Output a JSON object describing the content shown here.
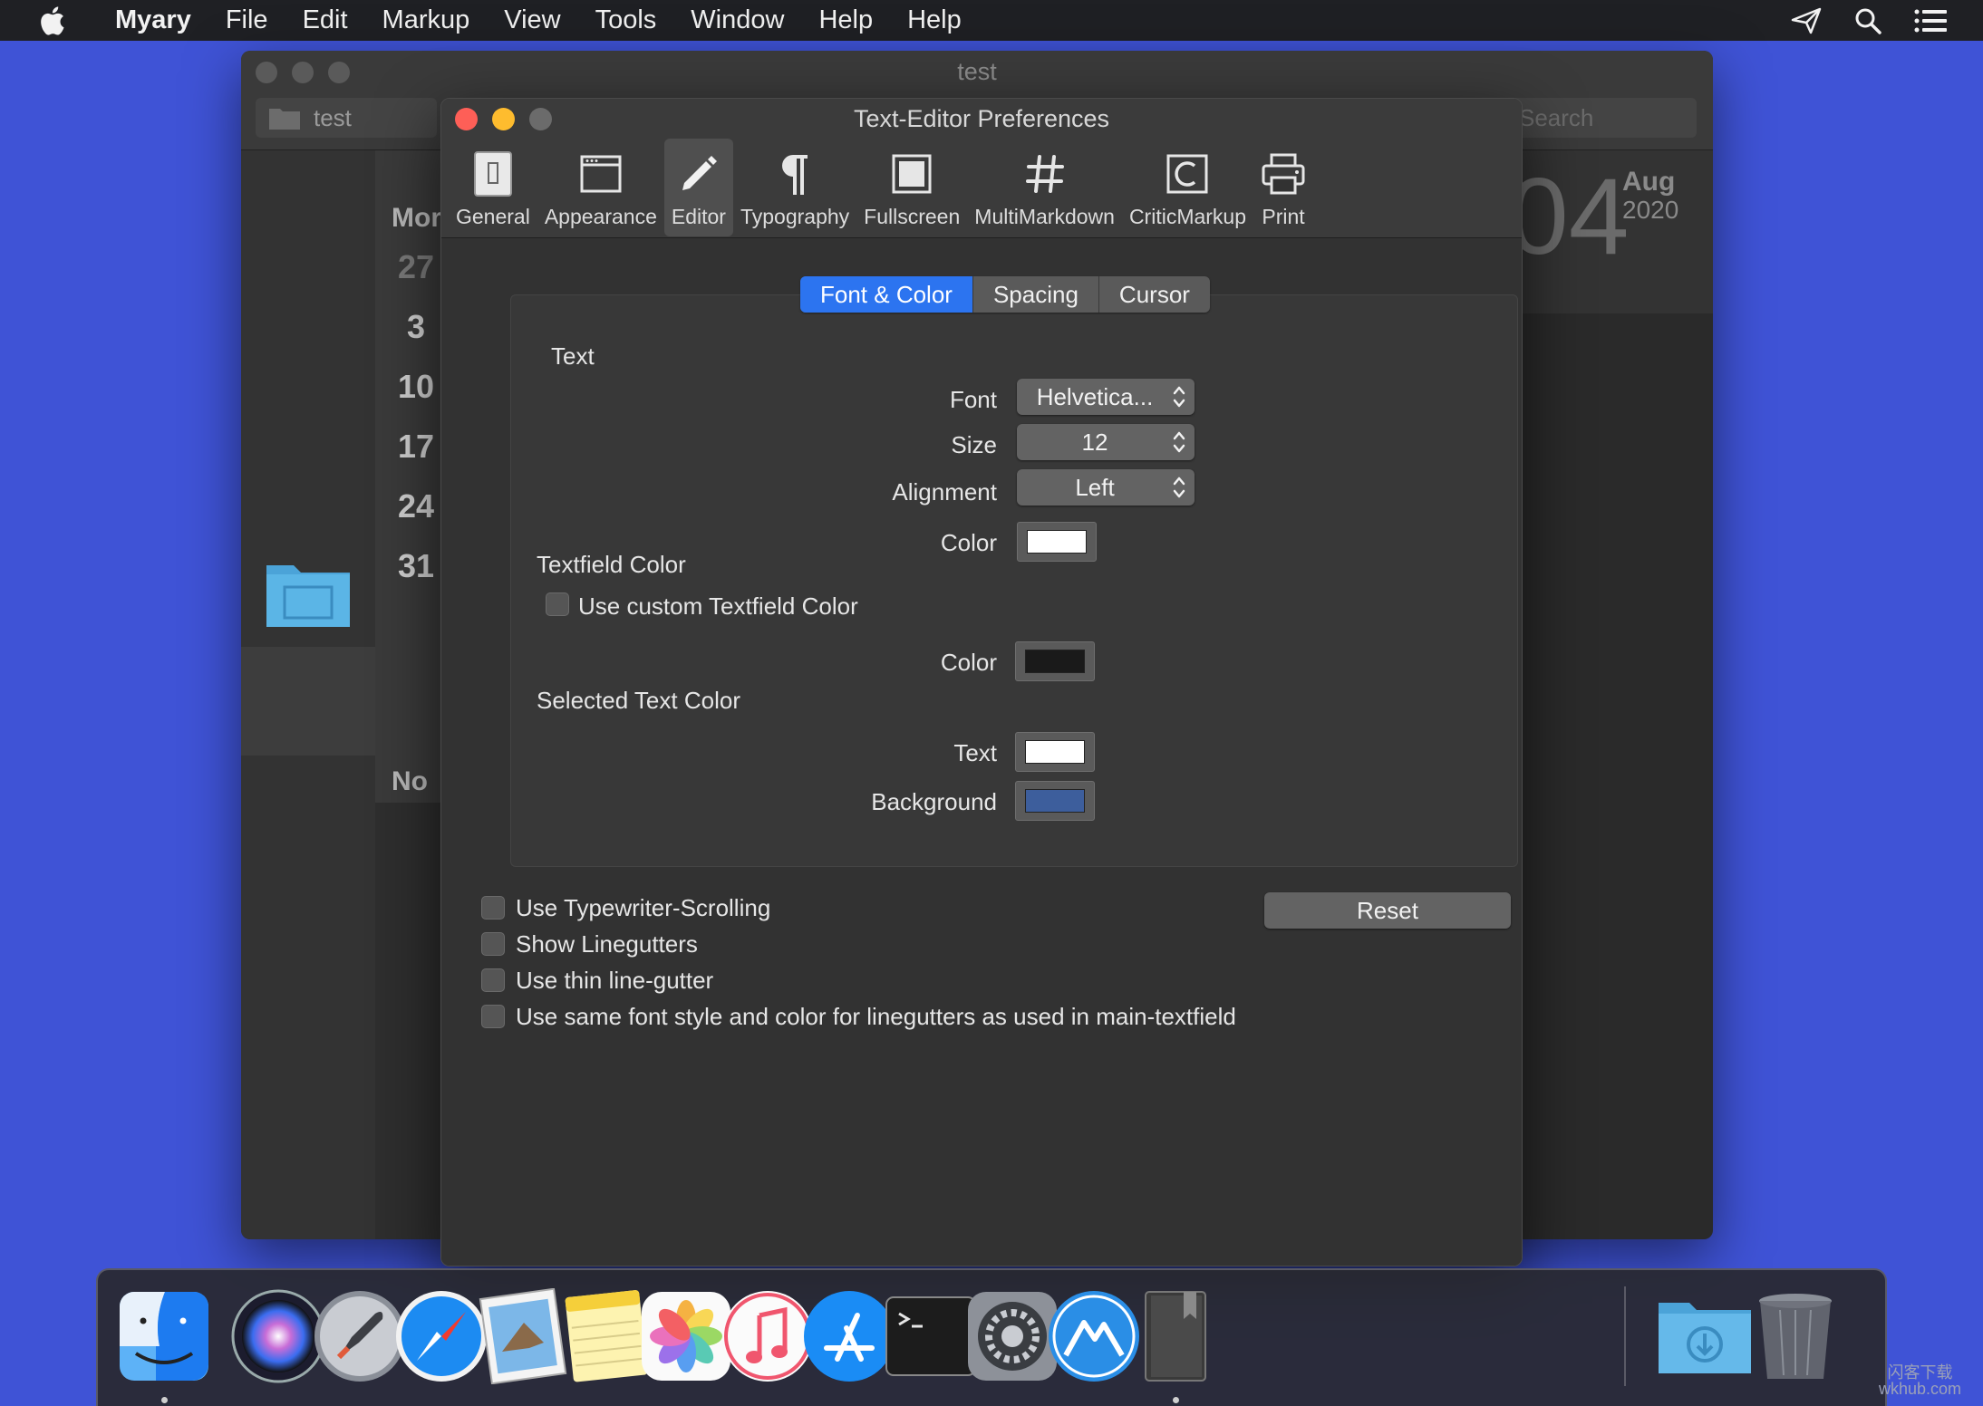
{
  "menubar": {
    "app_name": "Myary",
    "items": [
      "File",
      "Edit",
      "Markup",
      "View",
      "Tools",
      "Window",
      "Help",
      "Help"
    ]
  },
  "background_window": {
    "title": "test",
    "tab_label": "test",
    "search_placeholder": "Search",
    "weekday_header": "Mor",
    "dates": [
      "27",
      "3",
      "10",
      "17",
      "24",
      "31"
    ],
    "notes_header": "No",
    "big_day": "04",
    "month": "Aug",
    "year": "2020"
  },
  "prefs": {
    "title": "Text-Editor Preferences",
    "toolbar": [
      {
        "label": "General",
        "icon": "general-icon"
      },
      {
        "label": "Appearance",
        "icon": "appearance-icon"
      },
      {
        "label": "Editor",
        "icon": "pencil-icon",
        "active": true
      },
      {
        "label": "Typography",
        "icon": "pilcrow-icon"
      },
      {
        "label": "Fullscreen",
        "icon": "fullscreen-icon"
      },
      {
        "label": "MultiMarkdown",
        "icon": "hash-icon"
      },
      {
        "label": "CriticMarkup",
        "icon": "criticmarkup-icon"
      },
      {
        "label": "Print",
        "icon": "printer-icon"
      }
    ],
    "segments": [
      "Font & Color",
      "Spacing",
      "Cursor"
    ],
    "selected_segment": "Font & Color",
    "text_section": {
      "heading": "Text",
      "font_label": "Font",
      "font_value": "Helvetica...",
      "size_label": "Size",
      "size_value": "12",
      "alignment_label": "Alignment",
      "alignment_value": "Left",
      "color_label": "Color",
      "color_value": "#ffffff"
    },
    "textfield_section": {
      "heading": "Textfield Color",
      "checkbox_label": "Use custom Textfield Color",
      "checked": false,
      "color_label": "Color",
      "color_value": "#1a1a1a"
    },
    "selected_section": {
      "heading": "Selected Text Color",
      "text_label": "Text",
      "text_color": "#ffffff",
      "background_label": "Background",
      "background_color": "#3d5e9c"
    },
    "options": [
      {
        "label": "Use Typewriter-Scrolling",
        "checked": false
      },
      {
        "label": "Show Linegutters",
        "checked": false
      },
      {
        "label": "Use thin line-gutter",
        "checked": false
      },
      {
        "label": "Use same font style and color for linegutters as used in main-textfield",
        "checked": false
      }
    ],
    "reset_label": "Reset"
  },
  "dock": {
    "apps": [
      "Finder",
      "Siri",
      "Launchpad",
      "Safari",
      "Mail",
      "Notes",
      "Photos",
      "Music",
      "App Store",
      "Terminal",
      "System Preferences",
      "Myary",
      "Book",
      "Downloads",
      "Trash"
    ]
  },
  "watermark": {
    "line1": "闪客下载",
    "line2": "wkhub.com"
  },
  "colors": {
    "desktop": "#3f53d6",
    "accent": "#2c74f0",
    "close": "#fe5f57",
    "minimize": "#febc2e"
  }
}
